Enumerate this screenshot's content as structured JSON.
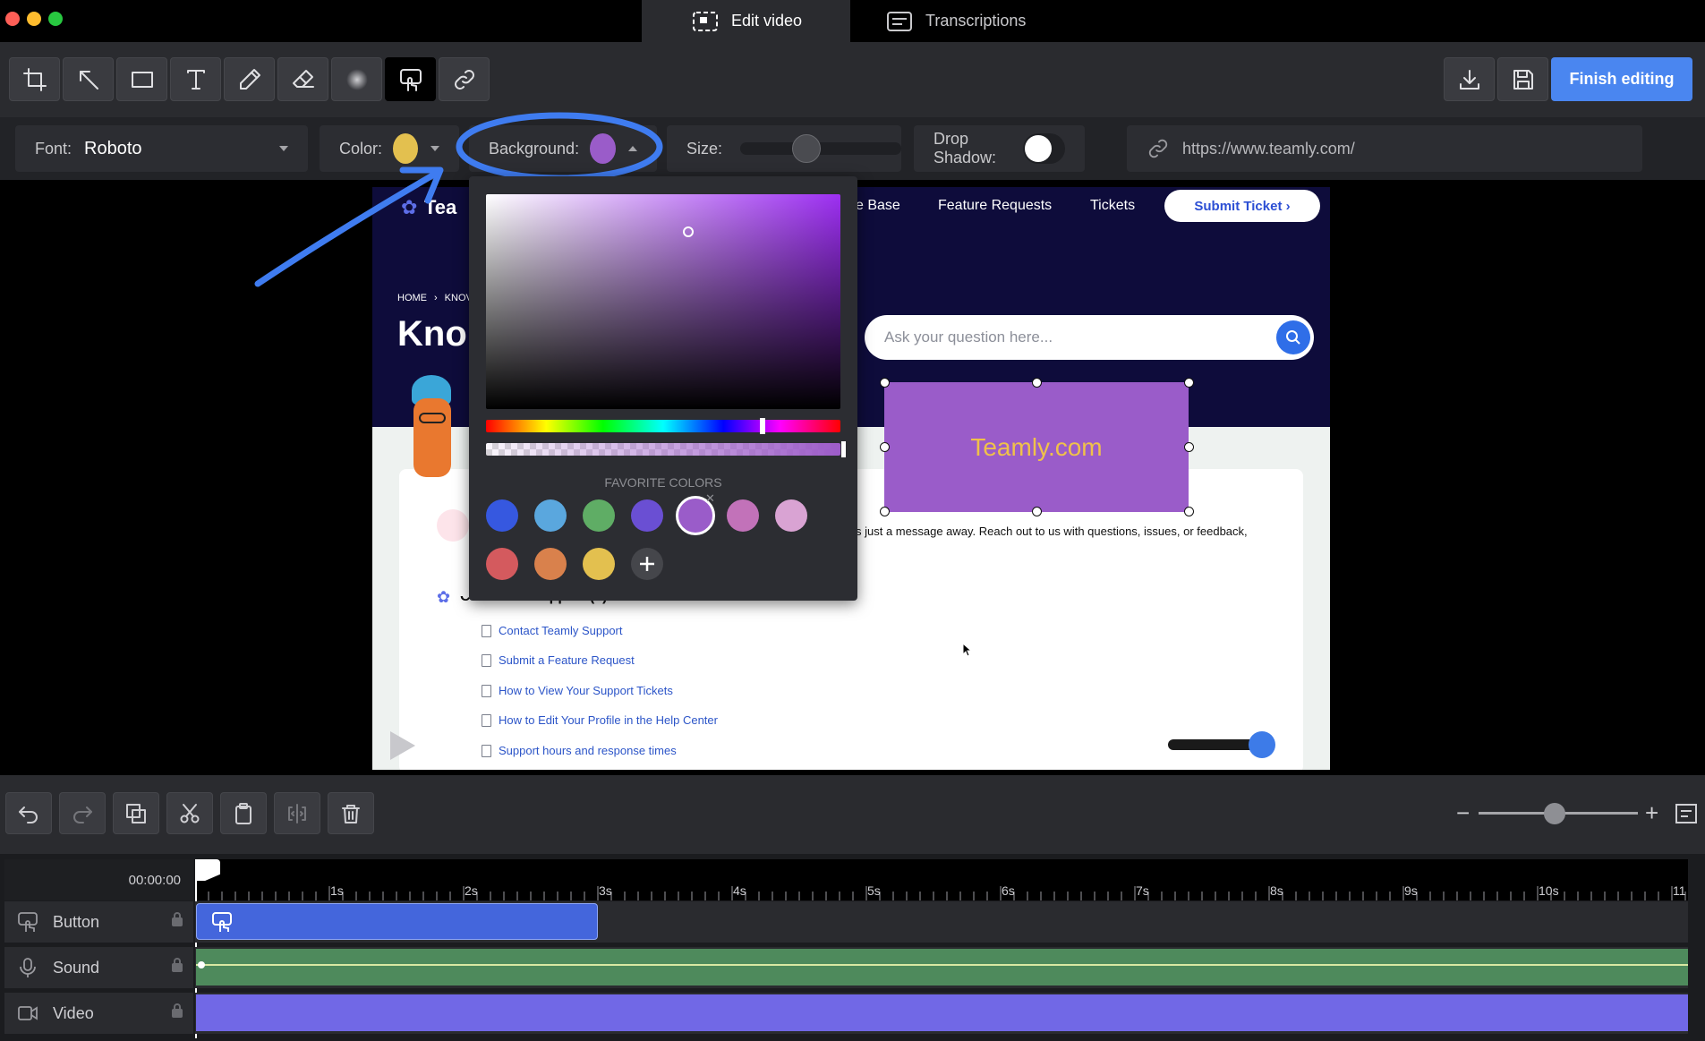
{
  "tabs": [
    {
      "label": "Edit video",
      "icon": "edit-video-icon",
      "active": true
    },
    {
      "label": "Transcriptions",
      "icon": "transcriptions-icon",
      "active": false
    }
  ],
  "toolbar": {
    "tools": [
      "crop-icon",
      "arrow-icon",
      "rectangle-icon",
      "text-icon",
      "pen-icon",
      "eraser-icon",
      "blur-icon",
      "button-icon",
      "link-icon"
    ],
    "selected_tool": "button-icon",
    "finish_label": "Finish editing"
  },
  "props": {
    "font_label": "Font:",
    "font_value": "Roboto",
    "color_label": "Color:",
    "color_value": "#e3c04f",
    "background_label": "Background:",
    "background_value": "#9a5cc9",
    "size_label": "Size:",
    "drop_shadow_label": "Drop Shadow:",
    "url_value": "https://www.teamly.com/"
  },
  "preview": {
    "nav": [
      "e Base",
      "Feature Requests",
      "Tickets"
    ],
    "submit_ticket": "Submit Ticket ›",
    "breadcrumb_home": "HOME",
    "breadcrumb_next": "KNOV",
    "heading": "Kno",
    "search_placeholder": "Ask your question here...",
    "message_text": "s just a message away. Reach out to us with questions, issues, or feedback,",
    "section_title": "Customer Support (5)",
    "links": [
      "Contact Teamly Support",
      "Submit a Feature Request",
      "How to View Your Support Tickets",
      "How to Edit Your Profile in the Help Center",
      "Support hours and response times"
    ],
    "logo_text": "Tea"
  },
  "overlay_button": {
    "text": "Teamly.com",
    "bg": "#9a5cc9",
    "fg": "#f0c14a"
  },
  "picker": {
    "favorites_label": "FAVORITE COLORS",
    "favorites": [
      "#3658e0",
      "#5aa7de",
      "#5fad65",
      "#6a4fd3",
      "#9a5cc9",
      "#c272b9",
      "#d9a3d3",
      "#d45a5e",
      "#d9814c",
      "#e3c04f"
    ],
    "selected_favorite": 4
  },
  "timeline": {
    "timecode": "00:00:00",
    "ticks": [
      "1s",
      "2s",
      "3s",
      "4s",
      "5s",
      "6s",
      "7s",
      "8s",
      "9s",
      "10s",
      "11"
    ],
    "tracks": [
      {
        "label": "Button",
        "icon": "button-track-icon"
      },
      {
        "label": "Sound",
        "icon": "microphone-icon"
      },
      {
        "label": "Video",
        "icon": "video-camera-icon"
      }
    ]
  },
  "colors": {
    "accent": "#4a86f0",
    "clip_button": "#4466dc",
    "clip_sound": "#4e8a5c",
    "clip_video": "#7168e6"
  }
}
